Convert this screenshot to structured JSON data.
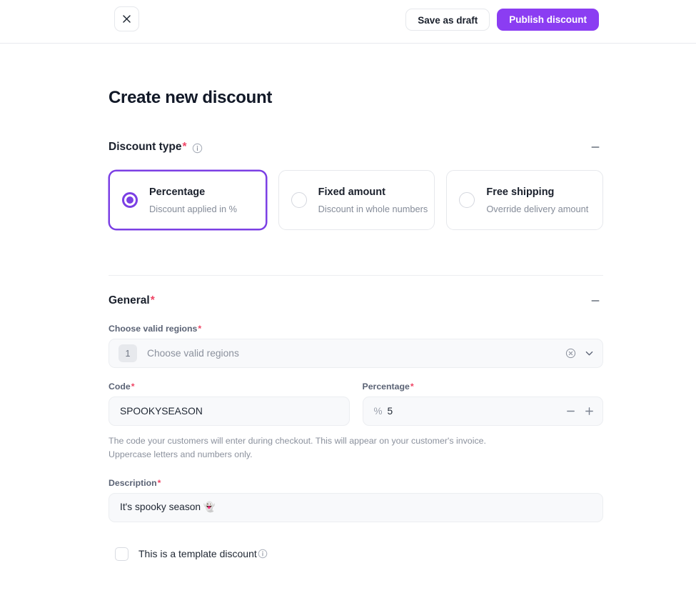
{
  "header": {
    "close_icon": "close-icon",
    "save_draft_label": "Save as draft",
    "publish_label": "Publish discount"
  },
  "colors": {
    "accent_purple": "#8B3DF2",
    "required_red": "#EF4565",
    "selected_border": "#7B3FE4",
    "input_bg": "#F8F9FB",
    "border": "#E6E8EC"
  },
  "page": {
    "title": "Create new discount"
  },
  "sections": [
    {
      "title": "Discount type",
      "required_mark": "*",
      "has_info_icon": true,
      "collapse_icon": "minus-icon"
    },
    {
      "title": "General",
      "required_mark": "*",
      "has_info_icon": false,
      "collapse_icon": "minus-icon"
    }
  ],
  "discount_type": {
    "options": [
      {
        "label": "Percentage",
        "description": "Discount applied in %",
        "selected": true
      },
      {
        "label": "Fixed amount",
        "description": "Discount in whole numbers",
        "selected": false
      },
      {
        "label": "Free shipping",
        "description": "Override delivery amount",
        "selected": false
      }
    ]
  },
  "general": {
    "regions": {
      "label": "Choose valid regions",
      "required_mark": "*",
      "badge_count": "1",
      "placeholder": "Choose valid regions",
      "clear_icon": "circle-x-icon",
      "chevron_icon": "chevron-down-icon"
    },
    "code": {
      "label": "Code",
      "required_mark": "*",
      "value": "SPOOKYSEASON"
    },
    "percentage": {
      "label": "Percentage",
      "required_mark": "*",
      "prefix": "%",
      "value": "5",
      "decrement_icon": "minus-icon",
      "increment_icon": "plus-icon"
    },
    "helper_line_1": "The code your customers will enter during checkout. This will appear on your customer's invoice.",
    "helper_line_2": "Uppercase letters and numbers only.",
    "description": {
      "label": "Description",
      "required_mark": "*",
      "value": "It's spooky season 👻"
    },
    "template_checkbox": {
      "label": "This is a template discount",
      "checked": false,
      "info_icon": "info-icon"
    }
  }
}
